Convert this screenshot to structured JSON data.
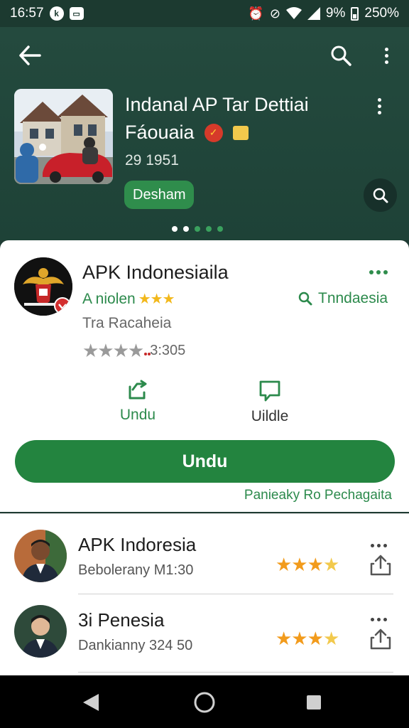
{
  "status_bar": {
    "time": "16:57",
    "left_icons": [
      "k-icon",
      "chat-icon"
    ],
    "battery_percent": "9%",
    "battery_percent_2": "250%"
  },
  "header": {
    "hero_title": "Indanal AP Tar Dettiai",
    "hero_sub": "Fáouaia",
    "hero_meta": "29 1951",
    "hero_chip": "Desham",
    "pager": {
      "count": 5,
      "active": [
        0,
        1
      ]
    }
  },
  "app": {
    "title": "APK Indonesiaila",
    "author": "A niolen",
    "author_stars": "★★★",
    "search_link": "Tnndaesia",
    "category": "Tra Racaheia",
    "rating_stars": "★★★★",
    "rating_count": "3:305",
    "actions": [
      {
        "label": "Undu",
        "icon": "download-share-icon"
      },
      {
        "label": "Uildle",
        "icon": "comment-icon"
      }
    ],
    "install_label": "Undu",
    "footer_text": "Panieaky Ro Pechagaita"
  },
  "list": [
    {
      "title": "APK Indoresia",
      "subtitle": "Bebolerany M1:30",
      "rating": 3.5
    },
    {
      "title": "3i Penesia",
      "subtitle": "Dankianny 324 50",
      "rating": 3.5
    }
  ],
  "colors": {
    "primary_green": "#23843f",
    "header_bg": "#244a3e",
    "star_orange": "#f29b1c"
  }
}
